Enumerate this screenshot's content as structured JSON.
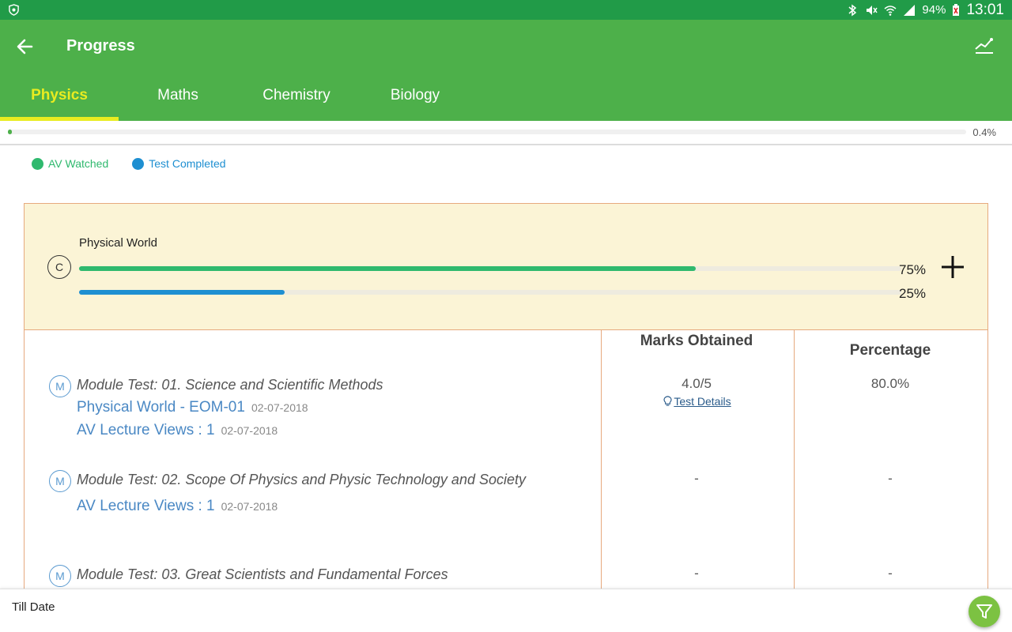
{
  "status": {
    "battery": "94%",
    "time": "13:01"
  },
  "header": {
    "title": "Progress"
  },
  "tabs": [
    {
      "label": "Physics"
    },
    {
      "label": "Maths"
    },
    {
      "label": "Chemistry"
    },
    {
      "label": "Biology"
    }
  ],
  "overall": {
    "percent_label": "0.4%",
    "fraction": 0.004
  },
  "legend": [
    {
      "label": "AV Watched",
      "color": "#2fb96e"
    },
    {
      "label": "Test Completed",
      "color": "#1e8fd1"
    }
  ],
  "chapter": {
    "badge": "C",
    "name": "Physical World",
    "av_pct_label": "75%",
    "av_fraction": 0.75,
    "test_pct_label": "25%",
    "test_fraction": 0.25
  },
  "table": {
    "col_marks": "Marks Obtained",
    "col_percentage": "Percentage"
  },
  "modules": [
    {
      "badge": "M",
      "title": "Module Test: 01. Science and Scientific Methods",
      "test_link": "Physical World - EOM-01",
      "test_date": "02-07-2018",
      "av_views": "AV Lecture Views : 1",
      "av_date": "02-07-2018",
      "marks": "4.0/5",
      "details": "Test Details",
      "percentage": "80.0%"
    },
    {
      "badge": "M",
      "title": "Module Test: 02. Scope Of Physics and Physic Technology and Society",
      "av_views": "AV Lecture Views : 1",
      "av_date": "02-07-2018",
      "marks": "-",
      "percentage": "-"
    },
    {
      "badge": "M",
      "title": "Module Test: 03. Great Scientists and Fundamental Forces",
      "marks": "-",
      "percentage": "-"
    }
  ],
  "footer": {
    "till_date": "Till Date"
  },
  "colors": {
    "status_bar": "#219b48",
    "app_bar": "#4db04a",
    "tab_active": "#e8ec20",
    "chapter_bg": "#fbf4d6",
    "card_border": "#e6a97e",
    "link": "#4a88c4",
    "fab": "#7cc242"
  },
  "icons": {
    "back": "arrow-left-icon",
    "trend": "trend-chart-icon",
    "expand": "plus-icon",
    "details": "lightbulb-icon",
    "filter": "filter-icon"
  }
}
